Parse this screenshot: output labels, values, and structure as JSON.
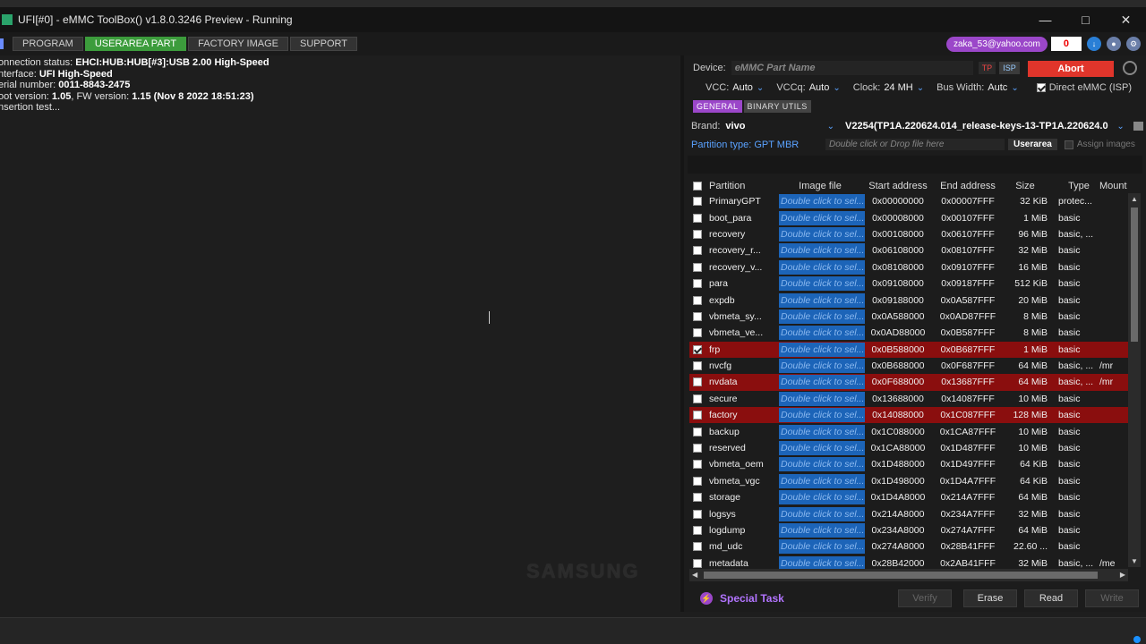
{
  "window": {
    "title": "UFI[#0] - eMMC ToolBox() v1.8.0.3246 Preview  - Running"
  },
  "menu": {
    "tabs": [
      {
        "label": "PROGRAM",
        "active": false
      },
      {
        "label": "USERAREA PART",
        "active": true
      },
      {
        "label": "FACTORY IMAGE",
        "active": false
      },
      {
        "label": "SUPPORT",
        "active": false
      }
    ]
  },
  "user": {
    "email": "zaka_53@yahoo.com",
    "credits": "0"
  },
  "log": {
    "lines": [
      {
        "label": "onnection status: ",
        "value": "EHCI:HUB:HUB[#3]:USB 2.00 High-Speed"
      },
      {
        "label": "nterface: ",
        "value": "UFI High-Speed"
      },
      {
        "label": "erial number: ",
        "value": "0011-8843-2475"
      },
      {
        "label": "oot version: ",
        "value": "1.05",
        "label2": ", FW version: ",
        "value2": "1.15 (Nov  8 2022 18:51:23)"
      },
      {
        "label": "nsertion test...",
        "value": ""
      }
    ],
    "watermark": "SAMSUNG"
  },
  "device": {
    "label": "Device:",
    "placeholder": "eMMC Part Name",
    "tp": "TP",
    "isp": "ISP",
    "abort": "Abort"
  },
  "power": {
    "vcc_label": "VCC:",
    "vcc": "Auto",
    "vccq_label": "VCCq:",
    "vccq": "Auto",
    "clock_label": "Clock:",
    "clock": "24 MH",
    "bus_label": "Bus Width:",
    "bus": "Autc",
    "direct": "Direct eMMC (ISP)"
  },
  "subtabs": [
    {
      "label": "GENERAL",
      "active": true
    },
    {
      "label": "BINARY UTILS",
      "active": false
    }
  ],
  "brand": {
    "label": "Brand:",
    "value": "vivo",
    "firmware": "V2254(TP1A.220624.014_release-keys-13-TP1A.220624.0"
  },
  "partition_type": {
    "label": "Partition type: GPT MBR",
    "drop": "Double click or Drop file here",
    "userarea": "Userarea",
    "assign": "Assign images"
  },
  "table": {
    "headers": {
      "partition": "Partition",
      "image": "Image file",
      "start": "Start address",
      "end": "End address",
      "size": "Size",
      "type": "Type",
      "mount": "Mount p"
    },
    "placeholder": "Double click to sel...",
    "rows": [
      {
        "name": "PrimaryGPT",
        "start": "0x00000000",
        "end": "0x00007FFF",
        "size": "32 KiB",
        "type": "protec...",
        "mount": "",
        "checked": false,
        "hl": false
      },
      {
        "name": "boot_para",
        "start": "0x00008000",
        "end": "0x00107FFF",
        "size": "1 MiB",
        "type": "basic",
        "mount": "",
        "checked": false,
        "hl": false
      },
      {
        "name": "recovery",
        "start": "0x00108000",
        "end": "0x06107FFF",
        "size": "96 MiB",
        "type": "basic, ...",
        "mount": "",
        "checked": false,
        "hl": false
      },
      {
        "name": "recovery_r...",
        "start": "0x06108000",
        "end": "0x08107FFF",
        "size": "32 MiB",
        "type": "basic",
        "mount": "",
        "checked": false,
        "hl": false
      },
      {
        "name": "recovery_v...",
        "start": "0x08108000",
        "end": "0x09107FFF",
        "size": "16 MiB",
        "type": "basic",
        "mount": "",
        "checked": false,
        "hl": false
      },
      {
        "name": "para",
        "start": "0x09108000",
        "end": "0x09187FFF",
        "size": "512 KiB",
        "type": "basic",
        "mount": "",
        "checked": false,
        "hl": false
      },
      {
        "name": "expdb",
        "start": "0x09188000",
        "end": "0x0A587FFF",
        "size": "20 MiB",
        "type": "basic",
        "mount": "",
        "checked": false,
        "hl": false
      },
      {
        "name": "vbmeta_sy...",
        "start": "0x0A588000",
        "end": "0x0AD87FFF",
        "size": "8 MiB",
        "type": "basic",
        "mount": "",
        "checked": false,
        "hl": false
      },
      {
        "name": "vbmeta_ve...",
        "start": "0x0AD88000",
        "end": "0x0B587FFF",
        "size": "8 MiB",
        "type": "basic",
        "mount": "",
        "checked": false,
        "hl": false
      },
      {
        "name": "frp",
        "start": "0x0B588000",
        "end": "0x0B687FFF",
        "size": "1 MiB",
        "type": "basic",
        "mount": "",
        "checked": true,
        "hl": true
      },
      {
        "name": "nvcfg",
        "start": "0x0B688000",
        "end": "0x0F687FFF",
        "size": "64 MiB",
        "type": "basic, ...",
        "mount": "/mr",
        "checked": false,
        "hl": false
      },
      {
        "name": "nvdata",
        "start": "0x0F688000",
        "end": "0x13687FFF",
        "size": "64 MiB",
        "type": "basic, ...",
        "mount": "/mr",
        "checked": false,
        "hl": true
      },
      {
        "name": "secure",
        "start": "0x13688000",
        "end": "0x14087FFF",
        "size": "10 MiB",
        "type": "basic",
        "mount": "",
        "checked": false,
        "hl": false
      },
      {
        "name": "factory",
        "start": "0x14088000",
        "end": "0x1C087FFF",
        "size": "128 MiB",
        "type": "basic",
        "mount": "",
        "checked": false,
        "hl": true
      },
      {
        "name": "backup",
        "start": "0x1C088000",
        "end": "0x1CA87FFF",
        "size": "10 MiB",
        "type": "basic",
        "mount": "",
        "checked": false,
        "hl": false
      },
      {
        "name": "reserved",
        "start": "0x1CA88000",
        "end": "0x1D487FFF",
        "size": "10 MiB",
        "type": "basic",
        "mount": "",
        "checked": false,
        "hl": false
      },
      {
        "name": "vbmeta_oem",
        "start": "0x1D488000",
        "end": "0x1D497FFF",
        "size": "64 KiB",
        "type": "basic",
        "mount": "",
        "checked": false,
        "hl": false
      },
      {
        "name": "vbmeta_vgc",
        "start": "0x1D498000",
        "end": "0x1D4A7FFF",
        "size": "64 KiB",
        "type": "basic",
        "mount": "",
        "checked": false,
        "hl": false
      },
      {
        "name": "storage",
        "start": "0x1D4A8000",
        "end": "0x214A7FFF",
        "size": "64 MiB",
        "type": "basic",
        "mount": "",
        "checked": false,
        "hl": false
      },
      {
        "name": "logsys",
        "start": "0x214A8000",
        "end": "0x234A7FFF",
        "size": "32 MiB",
        "type": "basic",
        "mount": "",
        "checked": false,
        "hl": false
      },
      {
        "name": "logdump",
        "start": "0x234A8000",
        "end": "0x274A7FFF",
        "size": "64 MiB",
        "type": "basic",
        "mount": "",
        "checked": false,
        "hl": false
      },
      {
        "name": "md_udc",
        "start": "0x274A8000",
        "end": "0x28B41FFF",
        "size": "22.60 ...",
        "type": "basic",
        "mount": "",
        "checked": false,
        "hl": false
      },
      {
        "name": "metadata",
        "start": "0x28B42000",
        "end": "0x2AB41FFF",
        "size": "32 MiB",
        "type": "basic, ...",
        "mount": "/me",
        "checked": false,
        "hl": false
      }
    ]
  },
  "actions": {
    "special": "Special Task",
    "verify": "Verify",
    "erase": "Erase",
    "read": "Read",
    "write": "Write"
  }
}
